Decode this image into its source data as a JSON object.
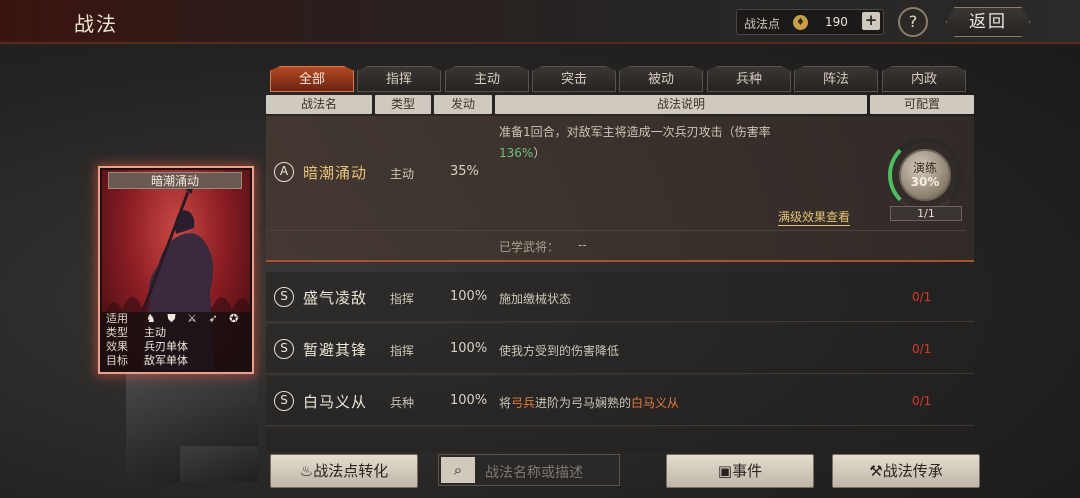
{
  "window": {
    "title": "战法"
  },
  "header": {
    "points_label": "战法点",
    "points_value": "190",
    "plus_label": "+",
    "help_label": "?",
    "back_label": "返回"
  },
  "tabs": [
    {
      "label": "全部",
      "active": true
    },
    {
      "label": "指挥"
    },
    {
      "label": "主动"
    },
    {
      "label": "突击"
    },
    {
      "label": "被动"
    },
    {
      "label": "兵种"
    },
    {
      "label": "阵法"
    },
    {
      "label": "内政"
    }
  ],
  "columns": {
    "name": "战法名",
    "type": "类型",
    "trigger": "发动",
    "desc": "战法说明",
    "config": "可配置"
  },
  "selected_skill": {
    "grade": "A",
    "name": "暗潮涌动",
    "type": "主动",
    "prob": "35%",
    "desc_line1": "准备1回合，对敌军主将造成一次兵刃攻击（伤害率",
    "desc_pct": "136%",
    "desc_close": "）",
    "learned_label": "已学武将：",
    "learned_value": "--",
    "max_effect_link": "满级效果查看",
    "drill_label": "演练",
    "drill_pct": "30%",
    "drill_count": "1/1"
  },
  "skills": [
    {
      "grade": "S",
      "name": "盛气凌敌",
      "type": "指挥",
      "prob": "100%",
      "desc": "施加缴械状态",
      "count": "0/1"
    },
    {
      "grade": "S",
      "name": "暂避其锋",
      "type": "指挥",
      "prob": "100%",
      "desc": "使我方受到的伤害降低",
      "count": "0/1"
    },
    {
      "grade": "S",
      "name": "白马义从",
      "type": "兵种",
      "prob": "100%",
      "desc_pre": "将",
      "desc_hl1": "弓兵",
      "desc_mid": "进阶为弓马娴熟的",
      "desc_hl2": "白马义从",
      "count": "0/1"
    }
  ],
  "card": {
    "title": "暗潮涌动",
    "rows": [
      {
        "label": "适用",
        "icons": "♞ ⛊ ⚔ ➶ ✪"
      },
      {
        "label": "类型",
        "value": "主动"
      },
      {
        "label": "效果",
        "value": "兵刃单体"
      },
      {
        "label": "目标",
        "value": "敌军单体"
      }
    ]
  },
  "footer": {
    "convert_label": "战法点转化",
    "search_placeholder": "战法名称或描述",
    "event_label": "事件",
    "inherit_label": "战法传承"
  },
  "colors": {
    "accent": "#b24a24",
    "highlight": "#e37a3a",
    "green": "#6fc07d",
    "count_red": "#d33a2a"
  }
}
